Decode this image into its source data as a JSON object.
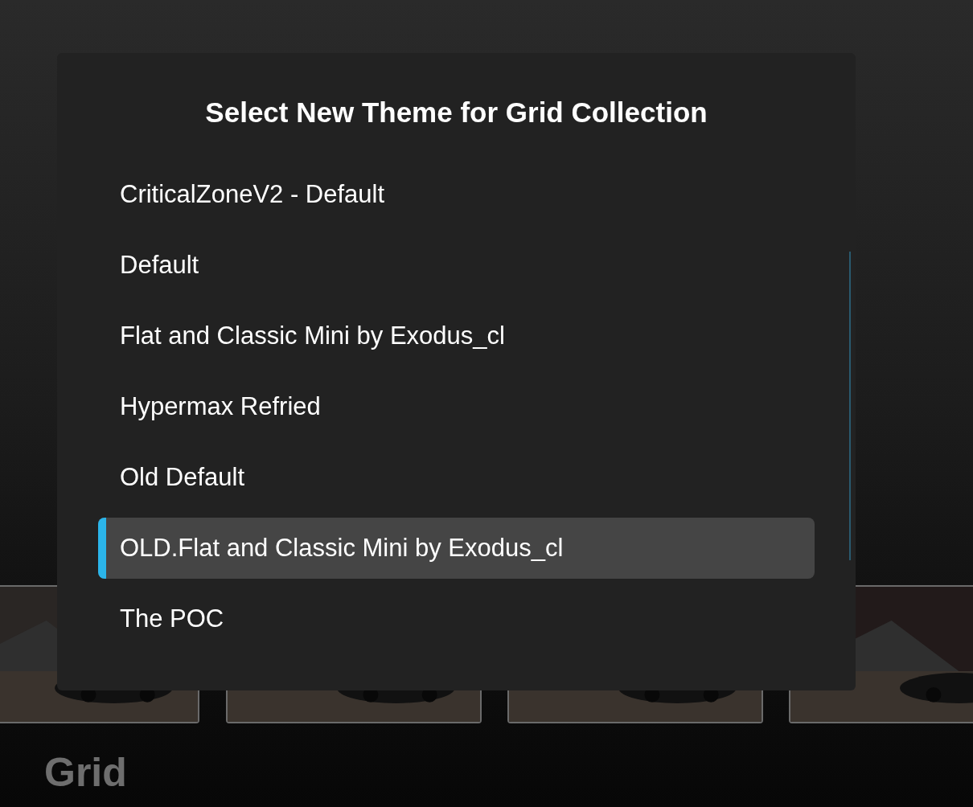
{
  "dialog": {
    "title": "Select New Theme for Grid Collection",
    "items": [
      {
        "label": "CriticalZoneV2 - Default",
        "selected": false
      },
      {
        "label": "Default",
        "selected": false
      },
      {
        "label": "Flat and Classic Mini by Exodus_cl",
        "selected": false
      },
      {
        "label": "Hypermax Refried",
        "selected": false
      },
      {
        "label": "Old Default",
        "selected": false
      },
      {
        "label": "OLD.Flat and Classic Mini by Exodus_cl",
        "selected": true
      },
      {
        "label": "The POC",
        "selected": false
      }
    ]
  },
  "collection_title": "Grid"
}
